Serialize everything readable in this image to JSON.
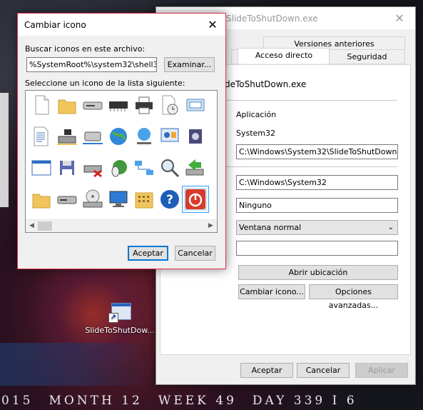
{
  "desktop": {
    "calendar_strip": [
      "015",
      "MONTH 12",
      "WEEK 49",
      "DAY 339 I 6"
    ],
    "shortcut_label": "SlideToShutDow..."
  },
  "properties_window": {
    "title": "SlideToShutDown.exe",
    "close_glyph": "✕",
    "tabs": {
      "versiones_anteriores": "Versiones anteriores",
      "acceso_directo": "Acceso directo",
      "seguridad": "Seguridad"
    },
    "shortcut_name": "deToShutDown.exe",
    "type_value": "Aplicación",
    "location_value": "System32",
    "target_value": "C:\\Windows\\System32\\SlideToShutDown.exe",
    "start_in_value": "C:\\Windows\\System32",
    "hotkey_value": "Ninguno",
    "run_value": "Ventana normal",
    "comment_value": "",
    "buttons": {
      "open_location": "Abrir ubicación",
      "change_icon": "Cambiar icono...",
      "advanced": "Opciones avanzadas...",
      "ok": "Aceptar",
      "cancel": "Cancelar",
      "apply": "Aplicar"
    }
  },
  "change_icon_dialog": {
    "title": "Cambiar icono",
    "close_glyph": "✕",
    "search_label": "Buscar iconos en este archivo:",
    "path_value": "%SystemRoot%\\system32\\shell32.dll",
    "browse_button": "Examinar...",
    "list_label": "Seleccione un icono de la lista siguiente:",
    "icons": [
      "blank-document-icon",
      "folder-icon",
      "floppy-drive-icon",
      "memory-chip-icon",
      "printer-icon",
      "document-clock-icon",
      "network-card-icon",
      "partial-icon",
      "text-document-icon",
      "network-drive-icon",
      "network-server-icon",
      "globe-icon",
      "network-globe-icon",
      "control-panel-icon",
      "package-icon",
      "shortcut-overlay-icon",
      "window-icon",
      "floppy-disk-icon",
      "disconnected-drive-icon",
      "mouse-globe-icon",
      "network-icon",
      "magnifier-icon",
      "green-arrow-drive-icon",
      "cd-partial-icon",
      "folder-icon",
      "hard-drive-icon",
      "dvd-drive-icon",
      "desktop-monitor-icon",
      "grid-folder-icon",
      "help-icon",
      "power-shutdown-icon",
      "partial-icon"
    ],
    "selected_index": 30,
    "ok_button": "Aceptar",
    "cancel_button": "Cancelar"
  },
  "colors": {
    "accent": "#0078d7",
    "dialog_border": "#d9344a",
    "shutdown_red": "#d83b2b",
    "help_blue": "#1c5fb8"
  }
}
